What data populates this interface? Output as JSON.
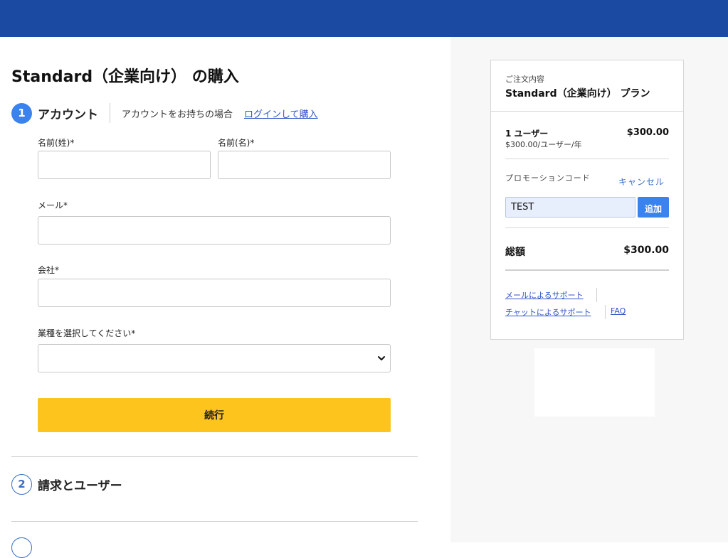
{
  "page": {
    "title": "Standard（企業向け） の購入"
  },
  "colors": {
    "header": "#1b4aa2",
    "accent": "#3a83ef",
    "continue_button": "#fec41e",
    "link": "#2f55c8"
  },
  "steps": [
    {
      "number": "1",
      "title": "アカウント",
      "state": "active"
    },
    {
      "number": "2",
      "title": "請求とユーザー",
      "state": "inactive"
    }
  ],
  "account": {
    "login_prompt": "アカウントをお持ちの場合",
    "login_link": "ログインして購入"
  },
  "form": {
    "last_name_label": "名前(姓)*",
    "last_name_value": "",
    "first_name_label": "名前(名)*",
    "first_name_value": "",
    "email_label": "メール*",
    "email_value": "",
    "company_label": "会社*",
    "company_value": "",
    "industry_label": "業種を選択してください*",
    "industry_value": "",
    "continue_label": "続行"
  },
  "order": {
    "caption": "ご注文内容",
    "plan_name": "Standard（企業向け） プラン",
    "line_item": {
      "title": "1 ユーザー",
      "subtitle": "$300.00/ユーザー/年",
      "price": "$300.00"
    },
    "promo": {
      "label": "プロモーションコード",
      "cancel": "キャンセル",
      "code_value": "TEST",
      "add_button": "追加"
    },
    "total_label": "総額",
    "total_price": "$300.00",
    "support": {
      "email": "メールによるサポート",
      "chat": "チャットによるサポート",
      "faq": "FAQ"
    }
  }
}
